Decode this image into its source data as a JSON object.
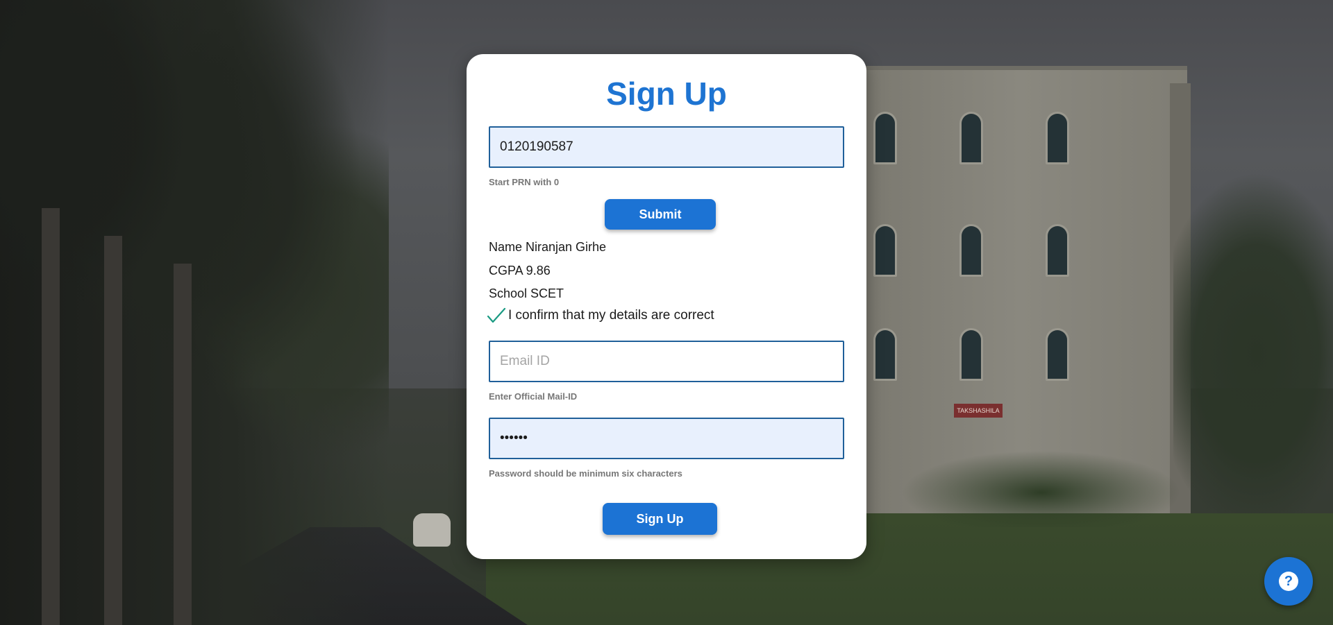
{
  "card": {
    "title": "Sign Up",
    "prn": {
      "value": "0120190587",
      "helper": "Start PRN with 0"
    },
    "submit_label": "Submit",
    "details": {
      "name": "Name Niranjan Girhe",
      "cgpa": "CGPA 9.86",
      "school": "School SCET"
    },
    "confirm_label": "I confirm that my details are correct",
    "confirm_checked": true,
    "email": {
      "value": "",
      "placeholder": "Email ID",
      "helper": "Enter Official Mail-ID"
    },
    "password": {
      "value_masked": "••••••",
      "helper": "Password should be minimum six characters"
    },
    "signup_label": "Sign Up"
  },
  "background": {
    "building_sign": "TAKSHASHILA"
  },
  "help_button": {
    "icon": "help-icon",
    "glyph": "?"
  },
  "colors": {
    "accent": "#1c73d4",
    "title": "#1e74d2",
    "check": "#1a9a82",
    "field_border": "#1f5f99",
    "field_fill": "#e8f0fd"
  }
}
